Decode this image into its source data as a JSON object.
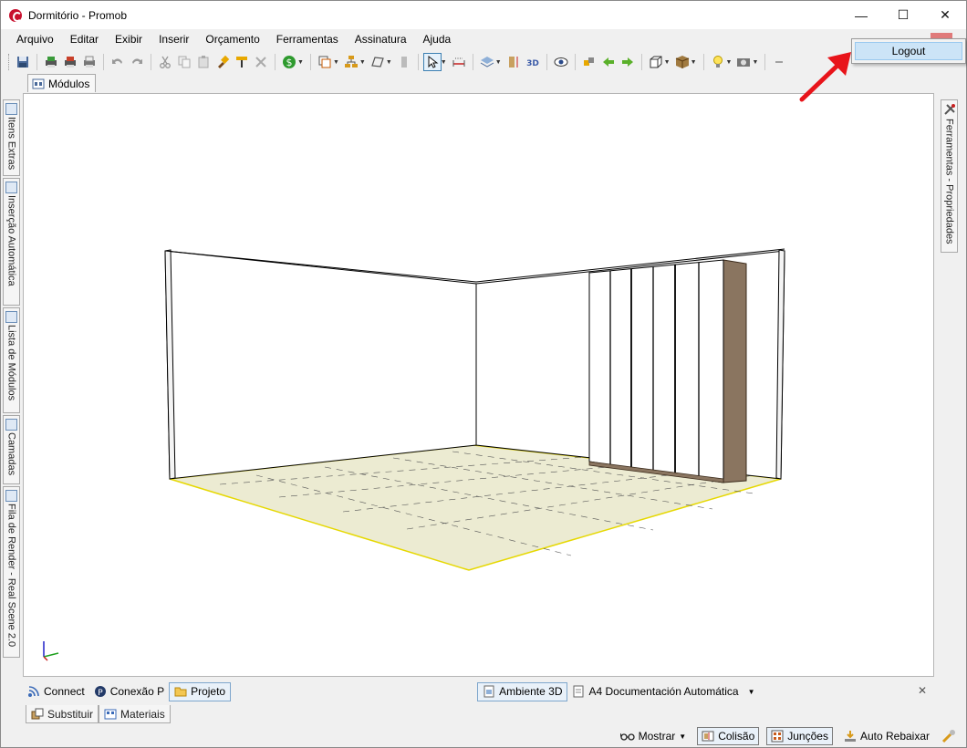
{
  "window": {
    "title": "Dormitório - Promob",
    "minimize": "—",
    "maximize": "☐",
    "close": "✕"
  },
  "menu": [
    "Arquivo",
    "Editar",
    "Exibir",
    "Inserir",
    "Orçamento",
    "Ferramentas",
    "Assinatura",
    "Ajuda"
  ],
  "popup": {
    "logout": "Logout"
  },
  "module_tab": "Módulos",
  "left_tabs": [
    "Itens Extras",
    "Inserção Automática",
    "Lista de Módulos",
    "Camadas",
    "Fila de Render - Real Scene 2.0"
  ],
  "right_tab": "Ferramentas - Propriedades",
  "bottom_tabs": {
    "connect": "Connect",
    "conexao": "Conexão P",
    "projeto": "Projeto",
    "ambiente": "Ambiente 3D",
    "doc": "A4 Documentación Automática",
    "close": "✕"
  },
  "bottom_tabs2": {
    "substituir": "Substituir",
    "materiais": "Materiais"
  },
  "status": {
    "mostrar": "Mostrar",
    "colisao": "Colisão",
    "juncoes": "Junções",
    "auto": "Auto Rebaixar"
  },
  "colors": {
    "accent": "#3c7fb1",
    "floor": "#ecebd2",
    "floor_edge": "#e6d800",
    "wood": "#8a7560",
    "logo": "#c8102e",
    "arrow": "#e8141a"
  }
}
